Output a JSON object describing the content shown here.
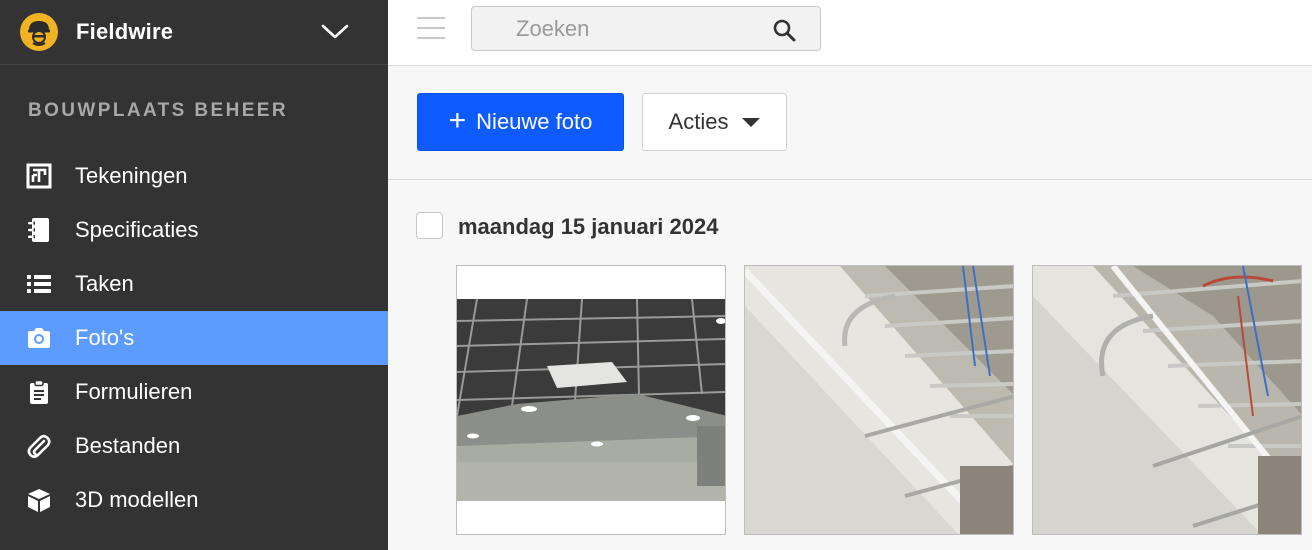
{
  "brand": {
    "name": "Fieldwire"
  },
  "sidebar": {
    "section_title": "BOUWPLAATS BEHEER",
    "items": [
      {
        "label": "Tekeningen",
        "icon": "plans-icon",
        "active": false
      },
      {
        "label": "Specificaties",
        "icon": "notebook-icon",
        "active": false
      },
      {
        "label": "Taken",
        "icon": "list-icon",
        "active": false
      },
      {
        "label": "Foto's",
        "icon": "camera-icon",
        "active": true
      },
      {
        "label": "Formulieren",
        "icon": "clipboard-icon",
        "active": false
      },
      {
        "label": "Bestanden",
        "icon": "paperclip-icon",
        "active": false
      },
      {
        "label": "3D modellen",
        "icon": "cube-icon",
        "active": false
      }
    ]
  },
  "topbar": {
    "search": {
      "placeholder": "Zoeken",
      "value": ""
    }
  },
  "actions": {
    "new_photo_label": "Nieuwe foto",
    "actions_label": "Acties"
  },
  "photos": {
    "groups": [
      {
        "date_label": "maandag 15 januari 2024",
        "items": [
          {
            "description": "suspended-ceiling-grid"
          },
          {
            "description": "ceiling-pipes-angle-1"
          },
          {
            "description": "ceiling-pipes-angle-2"
          }
        ]
      }
    ]
  },
  "colors": {
    "sidebar_bg": "#333333",
    "active_item": "#5c9bff",
    "primary_button": "#0e5cff",
    "brand_logo": "#f2b322"
  }
}
